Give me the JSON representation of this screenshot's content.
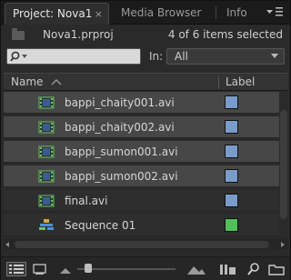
{
  "tabs": [
    {
      "label": "Project: Nova1",
      "active": true,
      "close": "×"
    },
    {
      "label": "Media Browser",
      "active": false
    },
    {
      "label": "Info",
      "active": false
    }
  ],
  "panel_menu_icon": "panel-menu-icon",
  "project": {
    "file_name": "Nova1.prproj",
    "selection_status": "4 of 6 items selected"
  },
  "search": {
    "value": "",
    "placeholder": ""
  },
  "in_filter": {
    "label": "In:",
    "value": "All"
  },
  "columns": {
    "name": "Name",
    "label": "Label"
  },
  "items": [
    {
      "name": "bappi_chaity001.avi",
      "type": "video-clip",
      "selected": true,
      "label_color": "#7a9ccc"
    },
    {
      "name": "bappi_chaity002.avi",
      "type": "video-clip",
      "selected": true,
      "label_color": "#7a9ccc"
    },
    {
      "name": "bappi_sumon001.avi",
      "type": "video-clip",
      "selected": true,
      "label_color": "#7a9ccc"
    },
    {
      "name": "bappi_sumon002.avi",
      "type": "video-clip",
      "selected": true,
      "label_color": "#7a9ccc"
    },
    {
      "name": "final.avi",
      "type": "video-clip",
      "selected": false,
      "label_color": "#7a9ccc"
    },
    {
      "name": "Sequence 01",
      "type": "sequence",
      "selected": false,
      "label_color": "#4fc05a"
    }
  ],
  "toolbar": {
    "icons": [
      "list-view-icon",
      "icon-view-icon",
      "zoom-out-icon",
      "zoom-slider",
      "zoom-in-icon",
      "automate-to-sequence-icon",
      "find-icon",
      "new-bin-icon"
    ]
  },
  "colors": {
    "selected_row": "#474747",
    "panel_bg": "#2a2a2a",
    "clip_label": "#7a9ccc",
    "sequence_label": "#4fc05a"
  }
}
